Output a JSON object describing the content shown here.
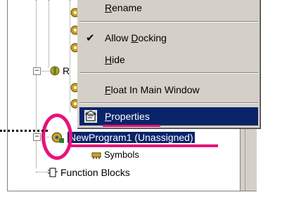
{
  "tree": {
    "r_label": "R",
    "program_label": "NewProgram1 (Unassigned)",
    "symbols_label": "Symbols",
    "function_blocks_label": "Function Blocks"
  },
  "menu": {
    "rename": {
      "pre": "",
      "accel": "R",
      "post": "ename"
    },
    "allow_docking": {
      "pre": "Allow ",
      "accel": "D",
      "post": "ocking"
    },
    "hide": {
      "pre": "",
      "accel": "H",
      "post": "ide"
    },
    "float": {
      "pre": "",
      "accel": "F",
      "post": "loat In Main Window"
    },
    "properties": {
      "pre": "",
      "accel": "P",
      "post": "roperties"
    },
    "check_glyph": "✔"
  },
  "colors": {
    "highlight": "#0a246a",
    "annotation": "#e8127a",
    "menu_bg": "#d4d0c8"
  }
}
